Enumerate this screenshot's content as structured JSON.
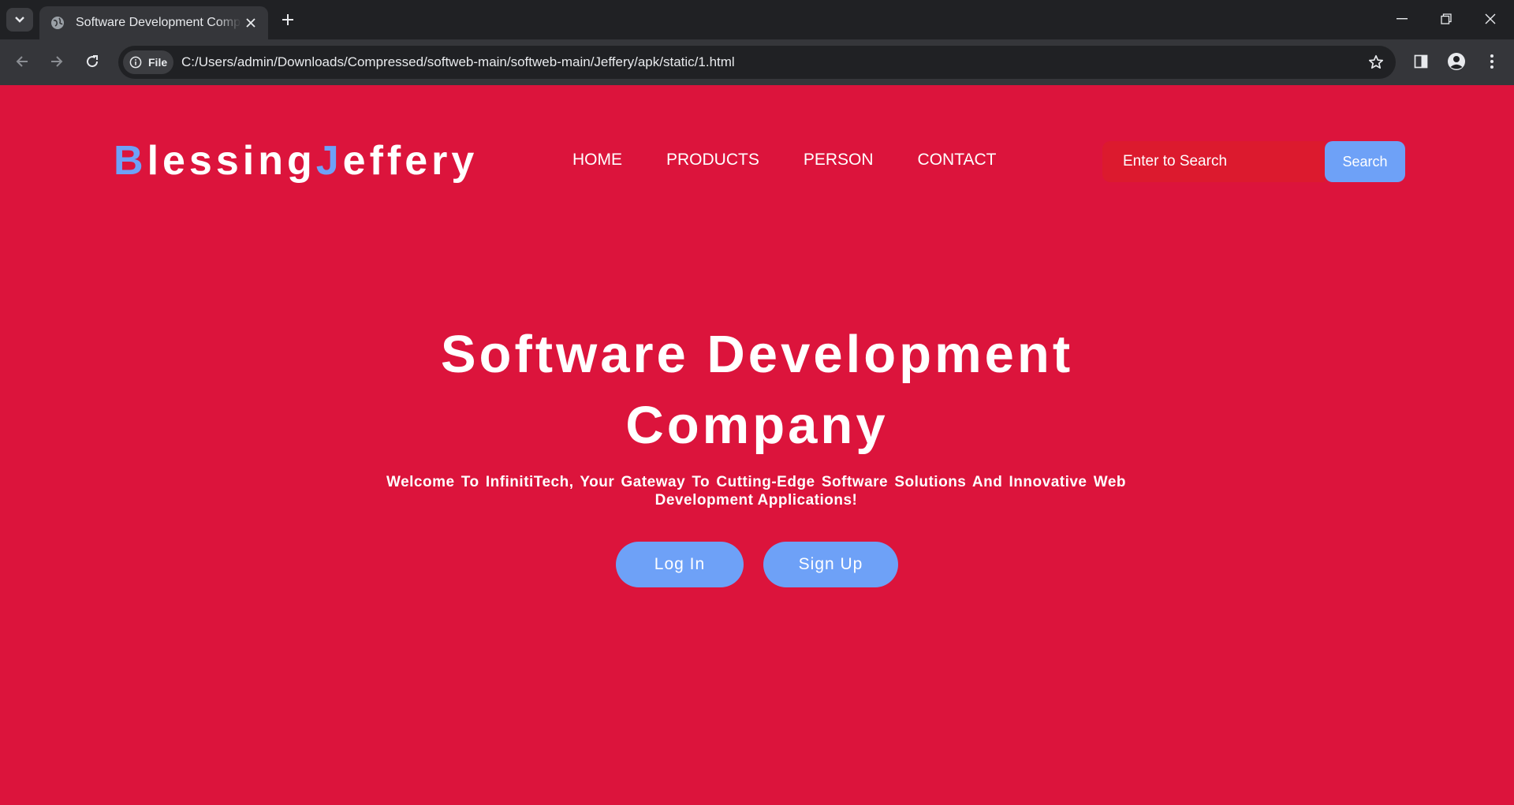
{
  "browser": {
    "tab_title": "Software Development Company",
    "site_chip_label": "File",
    "url": "C:/Users/admin/Downloads/Compressed/softweb-main/softweb-main/Jeffery/apk/static/1.html",
    "icons": [
      "tab-list-icon",
      "globe-icon",
      "close-icon",
      "plus-icon",
      "minimize-icon",
      "restore-icon",
      "close-window-icon",
      "back-icon",
      "forward-icon",
      "reload-icon",
      "info-icon",
      "star-icon",
      "side-panel-icon",
      "profile-icon",
      "menu-icon"
    ]
  },
  "page": {
    "logo": {
      "first_initial": "B",
      "first_rest": "lessing",
      "second_initial": "J",
      "second_rest": "effery"
    },
    "nav": [
      "HOME",
      "PRODUCTS",
      "PERSON",
      "CONTACT"
    ],
    "search": {
      "placeholder": "Enter to Search",
      "button_label": "Search"
    },
    "hero": {
      "title": "Software Development Company",
      "subtitle": "Welcome To InfinitiTech, Your Gateway To Cutting-Edge Software Solutions And Innovative Web Development Applications!",
      "login_label": "Log In",
      "signup_label": "Sign Up"
    }
  },
  "colors": {
    "page_background": "#dc143c",
    "accent": "#6ea1f7",
    "chrome_dark": "#202124",
    "chrome_toolbar": "#35363a"
  }
}
